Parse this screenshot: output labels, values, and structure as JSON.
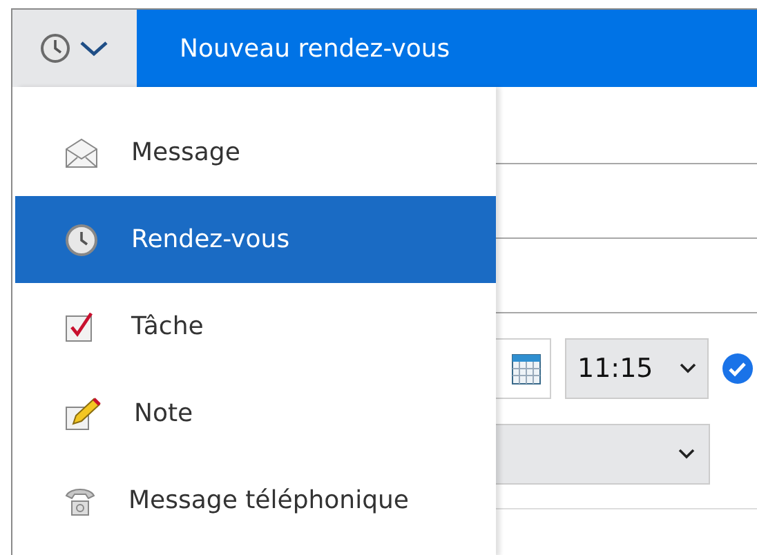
{
  "header": {
    "title": "Nouveau rendez-vous"
  },
  "menu": {
    "items": [
      {
        "label": "Message",
        "kind": "message",
        "selected": false
      },
      {
        "label": "Rendez-vous",
        "kind": "appointment",
        "selected": true
      },
      {
        "label": "Tâche",
        "kind": "task",
        "selected": false
      },
      {
        "label": "Note",
        "kind": "note",
        "selected": false
      },
      {
        "label": "Message téléphonique",
        "kind": "phone",
        "selected": false
      }
    ]
  },
  "form": {
    "time": "11:15"
  }
}
